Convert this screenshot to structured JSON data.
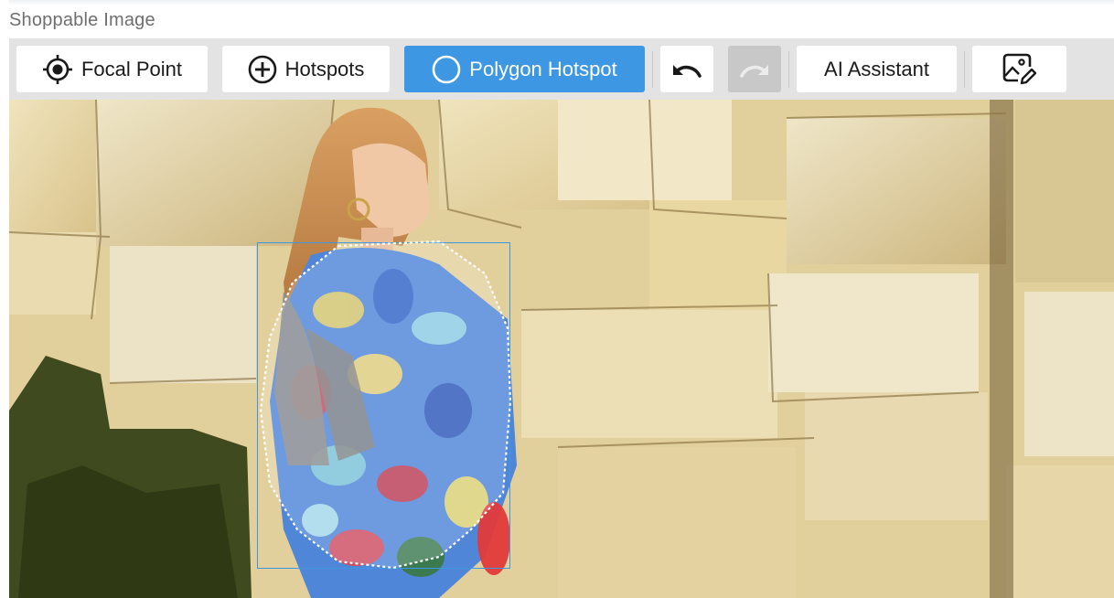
{
  "section": {
    "title": "Shoppable Image"
  },
  "toolbar": {
    "focal_point": {
      "label": "Focal Point",
      "icon": "focal-point-icon"
    },
    "hotspots": {
      "label": "Hotspots",
      "icon": "plus-circle-icon"
    },
    "polygon_hotspot": {
      "label": "Polygon Hotspot",
      "icon": "circle-icon",
      "active": true
    },
    "undo": {
      "icon": "undo-icon"
    },
    "redo": {
      "icon": "redo-icon",
      "disabled": true
    },
    "ai_assistant": {
      "label": "AI Assistant"
    },
    "image_edit": {
      "icon": "image-edit-icon"
    }
  },
  "colors": {
    "active": "#3d97e2",
    "toolbar_bg": "#e3e3e3",
    "disabled": "#c8c8c8",
    "hotspot_border": "#3d97e2"
  }
}
